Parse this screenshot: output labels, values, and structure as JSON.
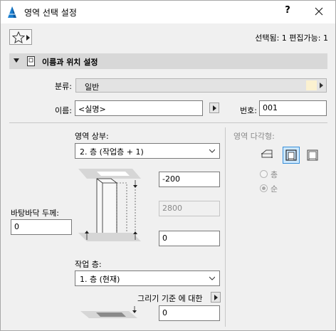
{
  "window": {
    "title": "영역 선택 설정",
    "help": "?",
    "selection_info": "선택됨: 1 편집가능: 1"
  },
  "section": {
    "title": "이름과 위치 설정"
  },
  "category": {
    "label": "분류:",
    "value": "일반",
    "swatch_color": "#fbf1d0"
  },
  "name": {
    "label": "이름:",
    "value": "<실명>"
  },
  "number": {
    "label": "번호:",
    "value": "001"
  },
  "top": {
    "label": "영역 상부:",
    "selected": "2. 층 (작업층 + 1)",
    "offset": "-200",
    "height": "2800"
  },
  "floor_thickness": {
    "label": "바탕바닥 두께:",
    "value": "0"
  },
  "bottom": {
    "offset": "0"
  },
  "home_story": {
    "label": "작업 층:",
    "selected": "1. 층 (현재)"
  },
  "reference": {
    "label": "그리기 기준 에 대한",
    "value": "0"
  },
  "polygon": {
    "label": "영역 다각형:",
    "radio_1": "총",
    "radio_2": "순"
  }
}
